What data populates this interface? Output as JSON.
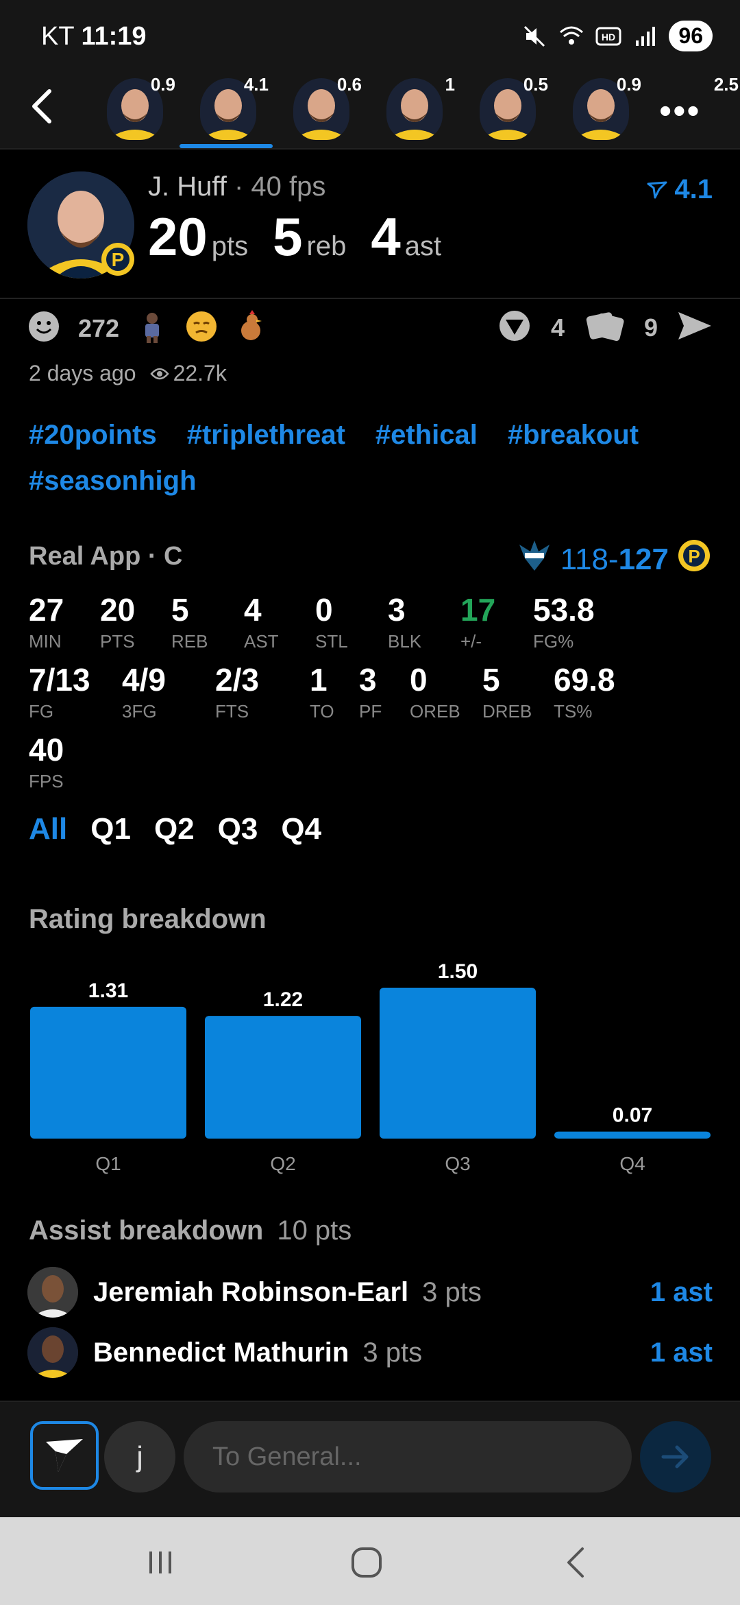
{
  "status_bar": {
    "carrier": "KT",
    "time": "11:19",
    "battery": "96"
  },
  "player_strip": {
    "ratings": [
      "0.9",
      "4.1",
      "0.6",
      "1",
      "0.5",
      "0.9",
      "2.5"
    ],
    "selected_index": 1
  },
  "header": {
    "name": "J. Huff",
    "fps_label": " · 40 fps",
    "rating": "4.1",
    "stats": [
      {
        "value": "20",
        "unit": "pts"
      },
      {
        "value": "5",
        "unit": "reb"
      },
      {
        "value": "4",
        "unit": "ast"
      }
    ]
  },
  "social": {
    "reaction_count": "272",
    "comments_count": "4",
    "cards_count": "9",
    "time_ago": "2 days ago",
    "views": "22.7k"
  },
  "hashtags": [
    "#20points",
    "#triplethreat",
    "#ethical",
    "#breakout",
    "#seasonhigh"
  ],
  "game": {
    "source": "Real App · C",
    "away_score": "118",
    "home_score": "127",
    "score_sep": "-"
  },
  "stats_row1": [
    {
      "v": "27",
      "l": "MIN"
    },
    {
      "v": "20",
      "l": "PTS"
    },
    {
      "v": "5",
      "l": "REB"
    },
    {
      "v": "4",
      "l": "AST"
    },
    {
      "v": "0",
      "l": "STL"
    },
    {
      "v": "3",
      "l": "BLK"
    },
    {
      "v": "17",
      "l": "+/-",
      "color": "#23a559"
    },
    {
      "v": "53.8",
      "l": "FG%"
    }
  ],
  "stats_row2": [
    {
      "v": "7/13",
      "l": "FG"
    },
    {
      "v": "4/9",
      "l": "3FG"
    },
    {
      "v": "2/3",
      "l": "FTS"
    },
    {
      "v": "1",
      "l": "TO"
    },
    {
      "v": "3",
      "l": "PF"
    },
    {
      "v": "0",
      "l": "OREB"
    },
    {
      "v": "5",
      "l": "DREB"
    },
    {
      "v": "69.8",
      "l": "TS%"
    }
  ],
  "stats_row3": [
    {
      "v": "40",
      "l": "FPS"
    }
  ],
  "quarter_tabs": [
    "All",
    "Q1",
    "Q2",
    "Q3",
    "Q4"
  ],
  "rating_breakdown": {
    "title": "Rating breakdown"
  },
  "chart_data": {
    "type": "bar",
    "categories": [
      "Q1",
      "Q2",
      "Q3",
      "Q4"
    ],
    "values": [
      1.31,
      1.22,
      1.5,
      0.07
    ],
    "value_labels": [
      "1.31",
      "1.22",
      "1.50",
      "0.07"
    ],
    "title": "Rating breakdown",
    "xlabel": "",
    "ylabel": "",
    "ylim": [
      0,
      1.5
    ],
    "color": "#0a84dc",
    "grid": false
  },
  "assist_breakdown": {
    "title": "Assist breakdown",
    "subtitle": "10 pts",
    "rows": [
      {
        "name": "Jeremiah Robinson-Earl",
        "pts": "3 pts",
        "ast": "1 ast"
      },
      {
        "name": "Bennedict Mathurin",
        "pts": "3 pts",
        "ast": "1 ast"
      }
    ]
  },
  "composer": {
    "user_initial": "j",
    "placeholder": "To General..."
  },
  "colors": {
    "accent": "#1e88e5",
    "positive": "#23a559",
    "background": "#000000"
  }
}
